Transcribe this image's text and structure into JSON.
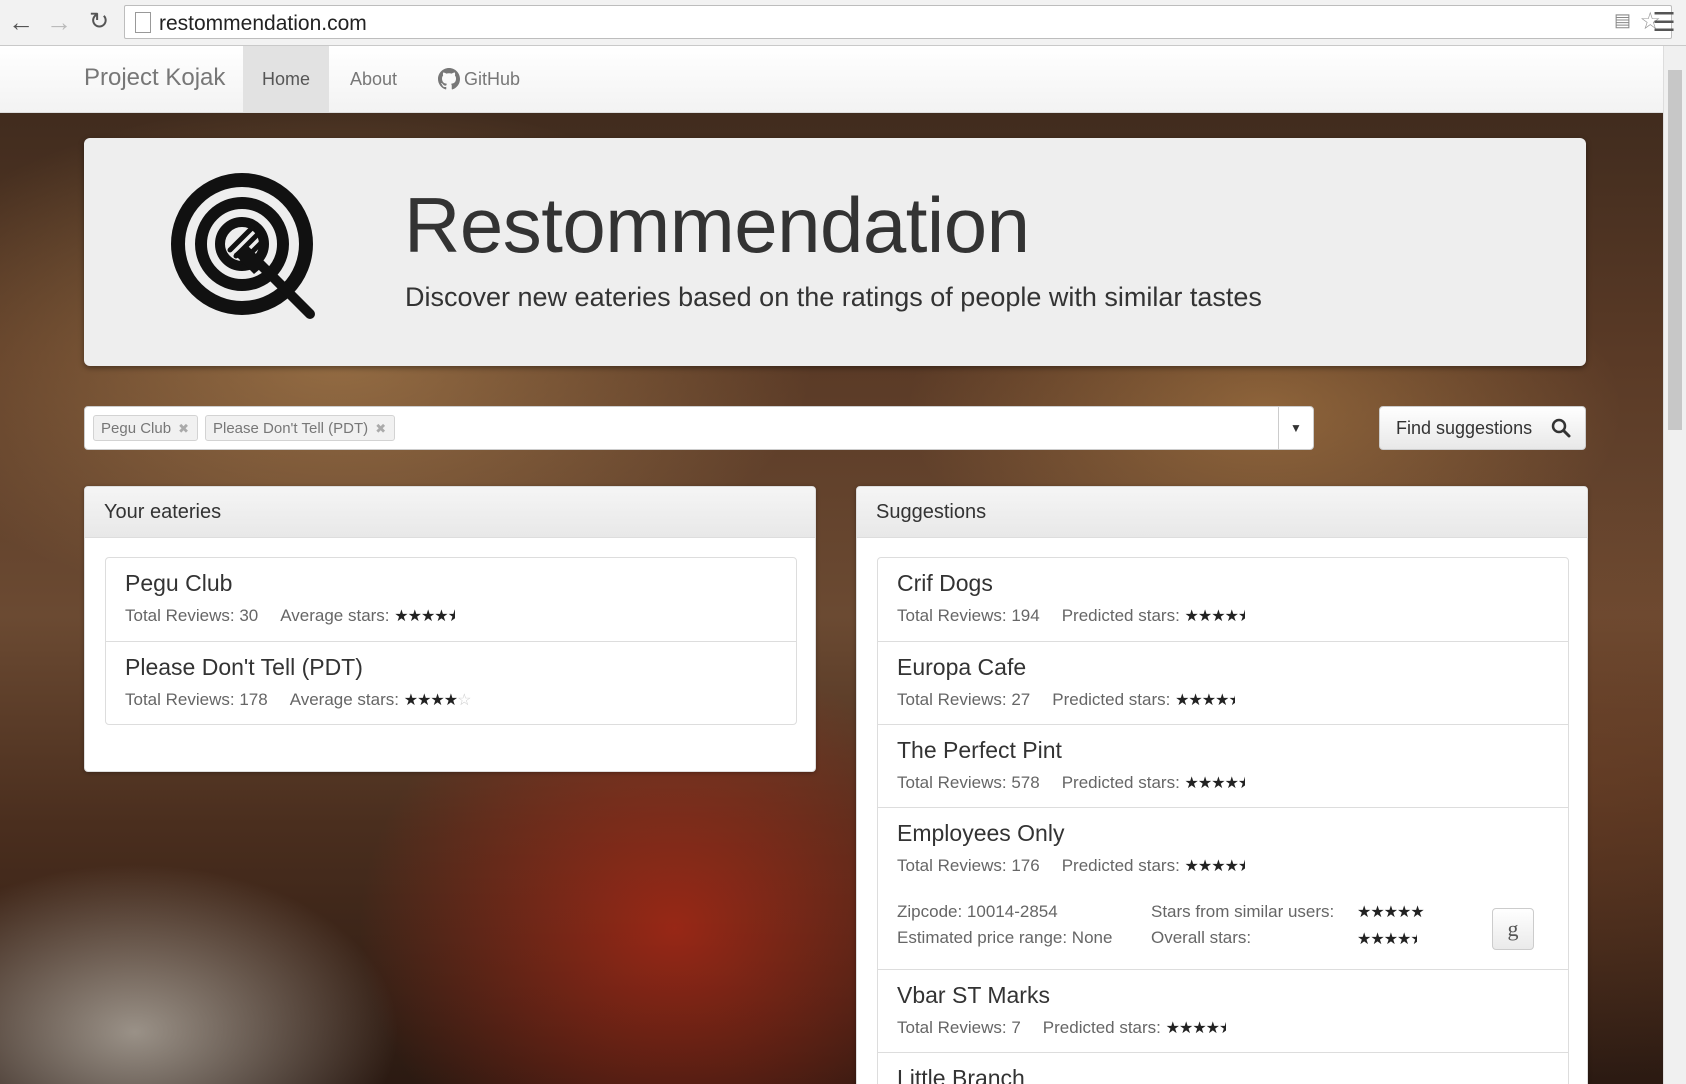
{
  "browser": {
    "url": "restommendation.com"
  },
  "navbar": {
    "brand": "Project Kojak",
    "links": [
      {
        "label": "Home",
        "active": true
      },
      {
        "label": "About",
        "active": false
      },
      {
        "label": "GitHub",
        "active": false
      }
    ]
  },
  "jumbotron": {
    "title": "Restommendation",
    "subtitle": "Discover new eateries based on the ratings of people with similar tastes"
  },
  "search": {
    "selected_tags": [
      "Pegu Club",
      "Please Don't Tell (PDT)"
    ],
    "find_button_label": "Find suggestions"
  },
  "your_eateries": {
    "heading": "Your eateries",
    "stat_label": "Average stars:",
    "items": [
      {
        "name": "Pegu Club",
        "total_reviews": "Total Reviews: 30",
        "stars": 4.5
      },
      {
        "name": "Please Don't Tell (PDT)",
        "total_reviews": "Total Reviews: 178",
        "stars": 4
      }
    ]
  },
  "suggestions": {
    "heading": "Suggestions",
    "stat_label": "Predicted stars:",
    "items": [
      {
        "name": "Crif Dogs",
        "total_reviews": "Total Reviews: 194",
        "stars": 4.5
      },
      {
        "name": "Europa Cafe",
        "total_reviews": "Total Reviews: 27",
        "stars": 4.5
      },
      {
        "name": "The Perfect Pint",
        "total_reviews": "Total Reviews: 578",
        "stars": 4.5
      },
      {
        "name": "Employees Only",
        "total_reviews": "Total Reviews: 176",
        "stars": 4.5,
        "details": {
          "zipcode": "Zipcode: 10014-2854",
          "price": "Estimated price range: None",
          "similar_label": "Stars from similar users:",
          "similar_stars": 5,
          "overall_label": "Overall stars:",
          "overall_stars": 4.5,
          "google_button": "g"
        }
      },
      {
        "name": "Vbar ST Marks",
        "total_reviews": "Total Reviews: 7",
        "stars": 4.5
      },
      {
        "name": "Little Branch",
        "total_reviews": "",
        "stars": null
      }
    ]
  }
}
